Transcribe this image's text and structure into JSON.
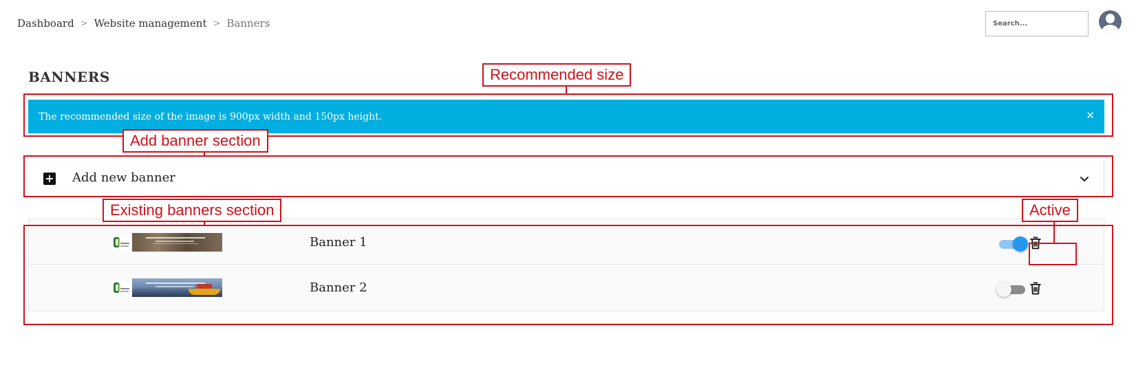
{
  "breadcrumb": {
    "items": [
      "Dashboard",
      "Website management",
      "Banners"
    ],
    "separator": ">"
  },
  "search": {
    "placeholder": "Search...",
    "value": ""
  },
  "page": {
    "title": "BANNERS"
  },
  "alert": {
    "message": "The recommended size of the image is 900px width and 150px height.",
    "close_icon": "close-icon",
    "color": "#00aee0"
  },
  "add_banner": {
    "label": "Add new banner",
    "icon": "plus-square-icon",
    "expand_icon": "chevron-down-icon"
  },
  "banners": [
    {
      "name": "Banner 1",
      "active": true
    },
    {
      "name": "Banner 2",
      "active": false
    }
  ],
  "annotations": {
    "recommended_size": "Recommended size",
    "add_banner_section": "Add banner section",
    "existing_banners_section": "Existing banners section",
    "active": "Active",
    "color": "#d0111b"
  },
  "colors": {
    "toggle_on": "#2296f3",
    "toggle_track_on": "#8ec5f2",
    "toggle_off_track": "#8c8c8c"
  }
}
